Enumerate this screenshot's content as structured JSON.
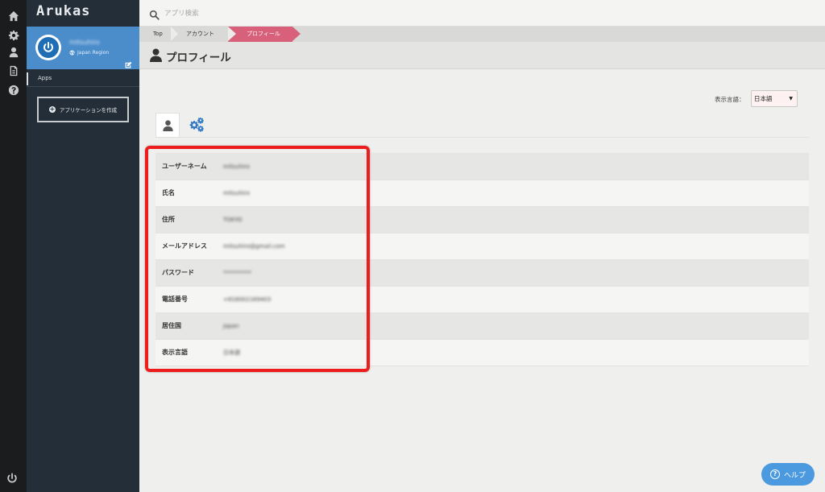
{
  "app": {
    "logo": "Arukas"
  },
  "rail": {
    "icons": [
      "home-icon",
      "gear-icon",
      "user-icon",
      "document-icon",
      "help-icon",
      "power-icon"
    ]
  },
  "sidebar": {
    "user_name": "mitsuhiro",
    "region": "Japan Region",
    "apps_label": "Apps",
    "create_button": "アプリケーションを作成"
  },
  "search": {
    "placeholder": "アプリ検索"
  },
  "breadcrumb": {
    "items": [
      "Top",
      "アカウント",
      "プロフィール"
    ]
  },
  "page": {
    "title": "プロフィール"
  },
  "language": {
    "label": "表示言語：",
    "selected": "日本語"
  },
  "profile": {
    "rows": [
      {
        "label": "ユーザーネーム",
        "value": "mitsuhiro"
      },
      {
        "label": "氏名",
        "value": "mitsuhiro"
      },
      {
        "label": "住所",
        "value": "TOKYO"
      },
      {
        "label": "メールアドレス",
        "value": "mitsuhiro@gmail.com"
      },
      {
        "label": "パスワード",
        "value": "**********"
      },
      {
        "label": "電話番号",
        "value": "+818002169403"
      },
      {
        "label": "居住国",
        "value": "Japan"
      },
      {
        "label": "表示言語",
        "value": "日本語"
      }
    ]
  },
  "help": {
    "label": "ヘルプ"
  },
  "colors": {
    "accent": "#d8607a",
    "highlight": "#ee1c1c",
    "user_box": "#4b8ccb",
    "help": "#4b9ae0"
  }
}
